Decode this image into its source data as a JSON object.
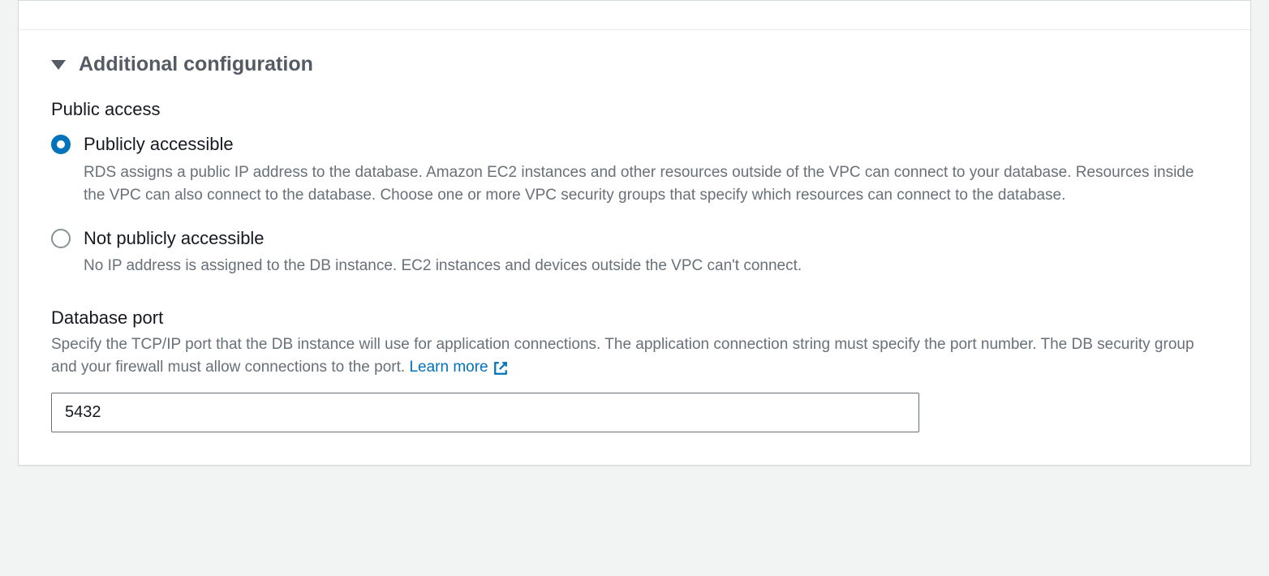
{
  "section": {
    "title": "Additional configuration"
  },
  "publicAccess": {
    "label": "Public access",
    "options": {
      "public": {
        "title": "Publicly accessible",
        "desc": "RDS assigns a public IP address to the database. Amazon EC2 instances and other resources outside of the VPC can connect to your database. Resources inside the VPC can also connect to the database. Choose one or more VPC security groups that specify which resources can connect to the database.",
        "selected": true
      },
      "notPublic": {
        "title": "Not publicly accessible",
        "desc": "No IP address is assigned to the DB instance. EC2 instances and devices outside the VPC can't connect.",
        "selected": false
      }
    }
  },
  "databasePort": {
    "label": "Database port",
    "desc": "Specify the TCP/IP port that the DB instance will use for application connections. The application connection string must specify the port number. The DB security group and your firewall must allow connections to the port. ",
    "learnMore": "Learn more",
    "value": "5432"
  }
}
